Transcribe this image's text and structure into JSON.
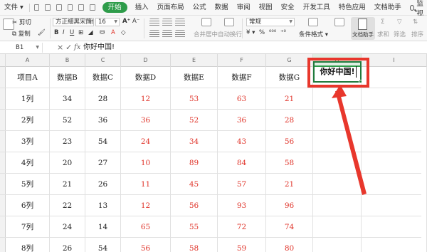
{
  "menu": {
    "file": "文件",
    "start": "开始",
    "items": [
      "插入",
      "页面布局",
      "公式",
      "数据",
      "审阅",
      "视图",
      "安全",
      "开发工具",
      "特色应用",
      "文档助手"
    ],
    "search": "监视"
  },
  "ribbon": {
    "cut": "剪切",
    "copy": "复制",
    "font_name": "方正細黑宋簡体",
    "font_size": "16",
    "merge_center": "合并居中",
    "auto_wrap": "自动换行",
    "number_format": "常规",
    "conditional_format": "条件格式",
    "doc_helper": "文档助手",
    "sum": "求和",
    "filter": "筛选",
    "sort": "排序"
  },
  "formula_bar": {
    "cell_ref": "B1",
    "cancel": "×",
    "confirm": "✓",
    "fx": "fx",
    "content": "你好中国!"
  },
  "columns": [
    "A",
    "B",
    "C",
    "D",
    "E",
    "F",
    "G",
    "H",
    "I"
  ],
  "active_column": "H",
  "table": {
    "headers": [
      "项目A",
      "数据B",
      "数据C",
      "数据D",
      "数据E",
      "数据F",
      "数据G"
    ],
    "rows": [
      [
        "1列",
        "34",
        "28",
        "12",
        "53",
        "63",
        "21"
      ],
      [
        "2列",
        "52",
        "36",
        "36",
        "52",
        "36",
        "28"
      ],
      [
        "3列",
        "23",
        "54",
        "24",
        "34",
        "43",
        "56"
      ],
      [
        "4列",
        "20",
        "27",
        "10",
        "89",
        "84",
        "58"
      ],
      [
        "5列",
        "21",
        "26",
        "11",
        "45",
        "57",
        "21"
      ],
      [
        "6列",
        "22",
        "13",
        "12",
        "56",
        "93",
        "96"
      ],
      [
        "7列",
        "24",
        "14",
        "65",
        "55",
        "72",
        "74"
      ],
      [
        "8列",
        "26",
        "54",
        "56",
        "58",
        "59",
        "80"
      ]
    ]
  },
  "selected_cell_text": "你好中国!",
  "colors": {
    "accent_green": "#2e9c4a",
    "value_red": "#e0352b",
    "annotation_red": "#e8372c"
  }
}
